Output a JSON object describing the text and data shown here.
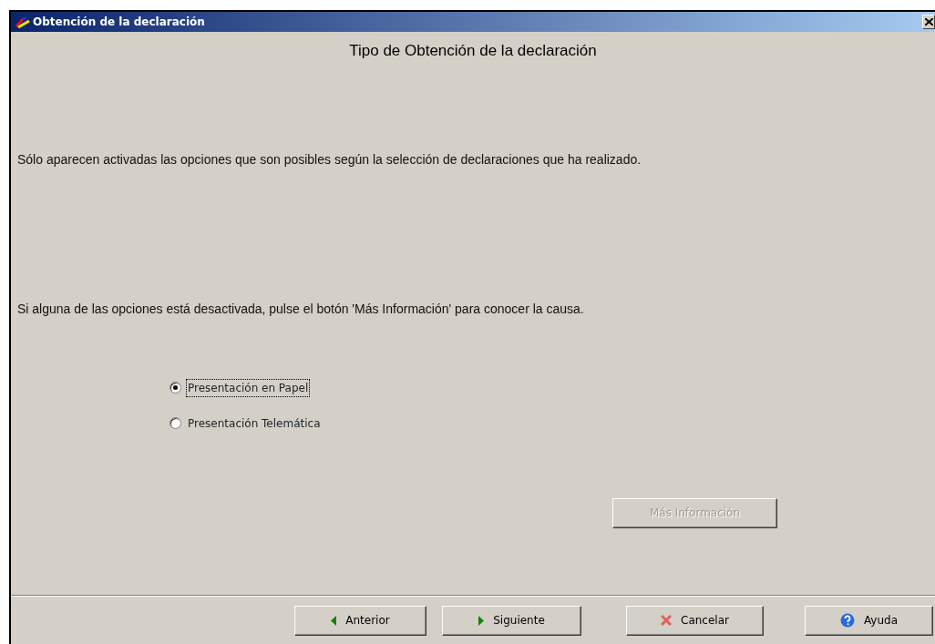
{
  "window": {
    "title": "Obtención de la declaración"
  },
  "heading": "Tipo de Obtención de la declaración",
  "paragraphs": [
    "Sólo aparecen activadas las opciones que son posibles según la selección de declaraciones que ha realizado.",
    "Si alguna de las opciones está desactivada, pulse el botón 'Más Información' para conocer la causa."
  ],
  "options": [
    {
      "label": "Presentación en Papel",
      "selected": true
    },
    {
      "label": "Presentación Telemática",
      "selected": false
    }
  ],
  "info_button": {
    "label": "Más Información",
    "disabled": true
  },
  "buttons": [
    {
      "label": "Anterior",
      "kind": "back"
    },
    {
      "label": "Siguiente",
      "kind": "next"
    },
    {
      "label": "Cancelar",
      "kind": "cancel"
    },
    {
      "label": "Ayuda",
      "kind": "help"
    }
  ]
}
